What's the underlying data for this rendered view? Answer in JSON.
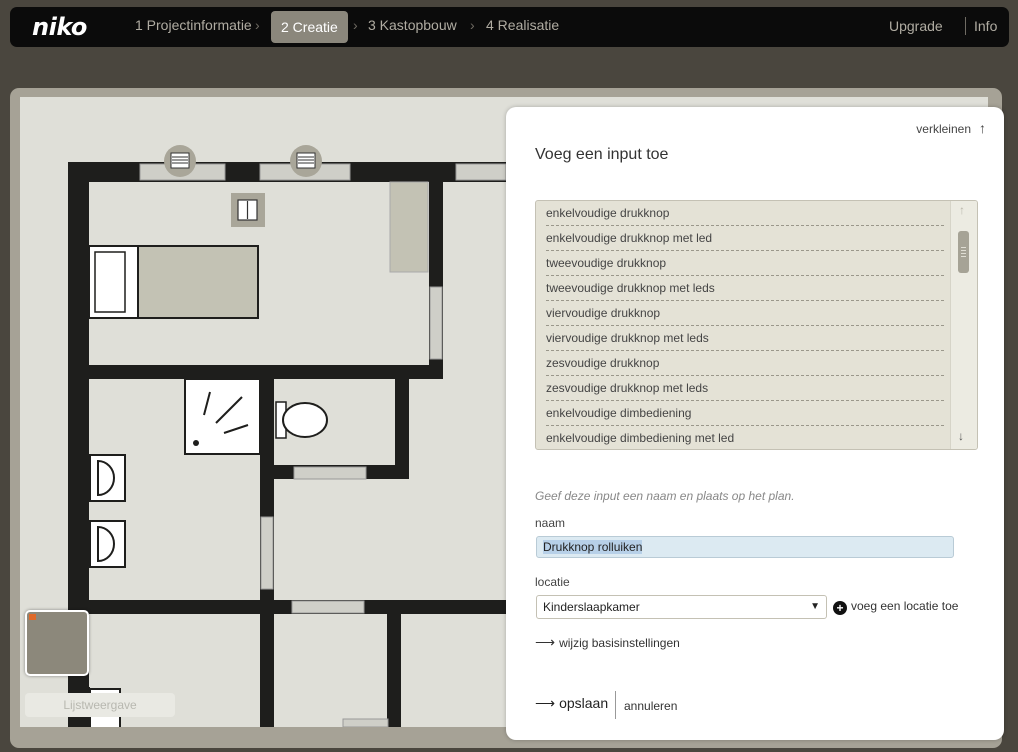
{
  "brand": {
    "logo": "niko"
  },
  "nav": {
    "steps": [
      {
        "label": "1 Projectinformatie",
        "active": false
      },
      {
        "label": "2 Creatie",
        "active": true
      },
      {
        "label": "3 Kastopbouw",
        "active": false
      },
      {
        "label": "4 Realisatie",
        "active": false
      }
    ],
    "upgrade": "Upgrade",
    "info": "Info"
  },
  "canvas": {
    "list_view_button": "Lijstweergave"
  },
  "panel": {
    "shrink_label": "verkleinen",
    "title": "Voeg een input toe",
    "input_types": [
      "enkelvoudige drukknop",
      "enkelvoudige drukknop met led",
      "tweevoudige drukknop",
      "tweevoudige drukknop met leds",
      "viervoudige drukknop",
      "viervoudige drukknop met leds",
      "zesvoudige drukknop",
      "zesvoudige drukknop met leds",
      "enkelvoudige dimbediening",
      "enkelvoudige dimbediening met led"
    ],
    "hint": "Geef deze input een naam en plaats op het plan.",
    "name_label": "naam",
    "name_value": "Drukknop rolluiken",
    "location_label": "locatie",
    "location_value": "Kinderslaapkamer",
    "add_location": "voeg een locatie toe",
    "settings_link": "wijzig basisinstellingen",
    "save": "opslaan",
    "cancel": "annuleren"
  },
  "colors": {
    "topbar": "#0b0b0b",
    "active_step": "#8b877c",
    "wall": "#1e1e1c",
    "floor": "#dfdfd8",
    "furniture": "#c3c2b4",
    "listbox": "#e4e2d6",
    "input_highlight": "#dceaf2"
  }
}
